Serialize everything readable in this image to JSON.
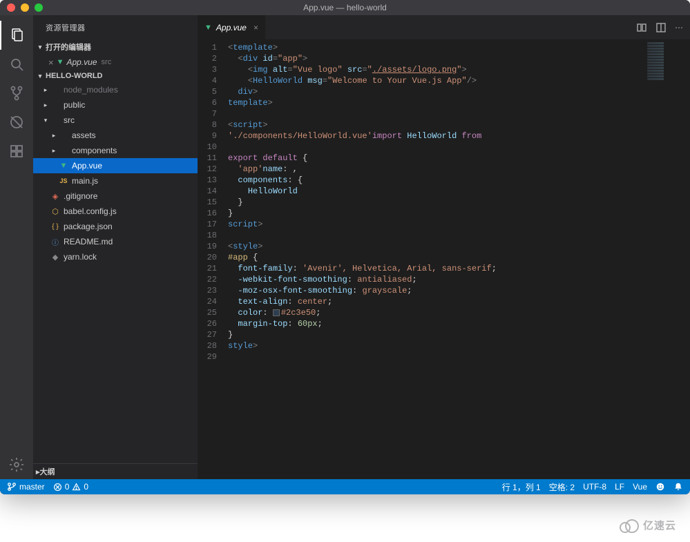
{
  "title": "App.vue — hello-world",
  "sidebar_title": "资源管理器",
  "open_editors_header": "打开的编辑器",
  "open_editor": {
    "name": "App.vue",
    "dir": "src"
  },
  "project_header": "HELLO-WORLD",
  "tree": [
    {
      "label": "node_modules",
      "type": "folder",
      "depth": 1,
      "expanded": false,
      "dim": true
    },
    {
      "label": "public",
      "type": "folder",
      "depth": 1,
      "expanded": false
    },
    {
      "label": "src",
      "type": "folder",
      "depth": 1,
      "expanded": true
    },
    {
      "label": "assets",
      "type": "folder",
      "depth": 2,
      "expanded": false
    },
    {
      "label": "components",
      "type": "folder",
      "depth": 2,
      "expanded": false
    },
    {
      "label": "App.vue",
      "type": "vue",
      "depth": 2,
      "selected": true
    },
    {
      "label": "main.js",
      "type": "js",
      "depth": 2
    },
    {
      "label": ".gitignore",
      "type": "git",
      "depth": 1
    },
    {
      "label": "babel.config.js",
      "type": "babel",
      "depth": 1
    },
    {
      "label": "package.json",
      "type": "json",
      "depth": 1
    },
    {
      "label": "README.md",
      "type": "md",
      "depth": 1
    },
    {
      "label": "yarn.lock",
      "type": "lock",
      "depth": 1
    }
  ],
  "outline_header": "大纲",
  "tab": {
    "name": "App.vue"
  },
  "code_lines": 29,
  "code": {
    "l1": {
      "tag": "<",
      "name": "template",
      "tag2": ">"
    },
    "l2": {
      "pad": "  ",
      "tag": "<",
      "name": "div ",
      "attr": "id",
      "eq": "=",
      "str": "\"app\"",
      "tag2": ">"
    },
    "l3": {
      "pad": "    ",
      "tag": "<",
      "name": "img ",
      "attr": "alt",
      "eq": "=",
      "str": "\"Vue logo\" ",
      "attr2": "src",
      "eq2": "=",
      "str2a": "\"",
      "link": "./assets/logo.png",
      "str2b": "\"",
      "tag2": ">"
    },
    "l4": {
      "pad": "    ",
      "tag": "<",
      "name": "HelloWorld ",
      "attr": "msg",
      "eq": "=",
      "str": "\"Welcome to Your Vue.js App\"",
      "tag2": "/>"
    },
    "l5": {
      "pad": "  ",
      "tag": "</",
      "name": "div",
      "tag2": ">"
    },
    "l6": {
      "tag": "</",
      "name": "template",
      "tag2": ">"
    },
    "l8": {
      "tag": "<",
      "name": "script",
      "tag2": ">"
    },
    "l9": {
      "kw": "import ",
      "var": "HelloWorld ",
      "kw2": "from ",
      "str": "'./components/HelloWorld.vue'"
    },
    "l11": {
      "kw": "export default ",
      "p": "{"
    },
    "l12": {
      "pad": "  ",
      "prop": "name",
      "col": ": ",
      "str": "'app'",
      "c": ","
    },
    "l13": {
      "pad": "  ",
      "prop": "components",
      "col": ": {"
    },
    "l14": {
      "pad": "    ",
      "var": "HelloWorld"
    },
    "l15": {
      "pad": "  ",
      "p": "}"
    },
    "l16": {
      "p": "}"
    },
    "l17": {
      "tag": "</",
      "name": "script",
      "tag2": ">"
    },
    "l19": {
      "tag": "<",
      "name": "style",
      "tag2": ">"
    },
    "l20": {
      "sel": "#app ",
      "p": "{"
    },
    "l21": {
      "pad": "  ",
      "prop": "font-family",
      "col": ": ",
      "val": "'Avenir', Helvetica, Arial, sans-serif",
      ";": ";"
    },
    "l22": {
      "pad": "  ",
      "prop": "-webkit-font-smoothing",
      "col": ": ",
      "val": "antialiased",
      ";": ";"
    },
    "l23": {
      "pad": "  ",
      "prop": "-moz-osx-font-smoothing",
      "col": ": ",
      "val": "grayscale",
      ";": ";"
    },
    "l24": {
      "pad": "  ",
      "prop": "text-align",
      "col": ": ",
      "val": "center",
      ";": ";"
    },
    "l25": {
      "pad": "  ",
      "prop": "color",
      "col": ": ",
      "color": "#2c3e50",
      "val": "#2c3e50",
      ";": ";"
    },
    "l26": {
      "pad": "  ",
      "prop": "margin-top",
      "col": ": ",
      "num": "60px",
      ";": ";"
    },
    "l27": {
      "p": "}"
    },
    "l28": {
      "tag": "</",
      "name": "style",
      "tag2": ">"
    }
  },
  "status": {
    "branch": "master",
    "errors": "0",
    "warnings": "0",
    "lncol": "行 1，列 1",
    "spaces": "空格: 2",
    "encoding": "UTF-8",
    "eol": "LF",
    "lang": "Vue"
  },
  "watermark": "亿速云"
}
